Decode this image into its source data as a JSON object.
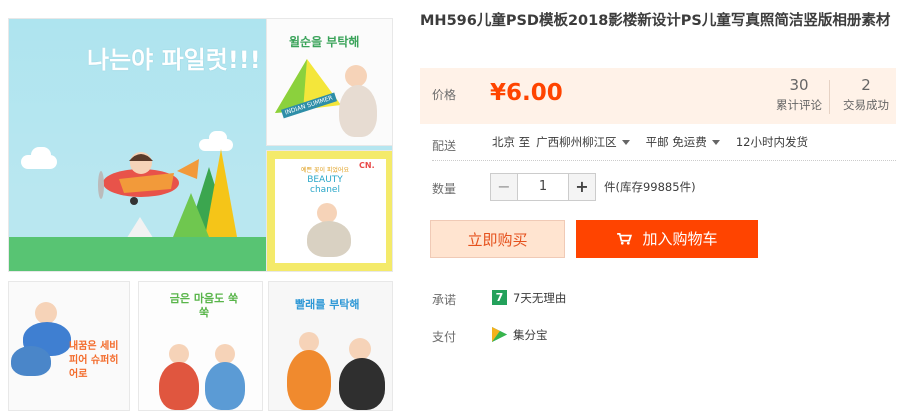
{
  "product": {
    "title": "MH596儿童PSD模板2018影楼新设计PS儿童写真照简洁竖版相册素材"
  },
  "price": {
    "label": "价格",
    "value": "¥6.00",
    "reviews_count": "30",
    "reviews_label": "累计评论",
    "sales_count": "2",
    "sales_label": "交易成功"
  },
  "shipping": {
    "label": "配送",
    "from": "北京 至",
    "to": "广西柳州柳江区",
    "method": "平邮 免运费",
    "dispatch": "12小时内发货"
  },
  "quantity": {
    "label": "数量",
    "minus": "−",
    "value": "1",
    "plus": "+",
    "stock": "件(库存99885件)"
  },
  "actions": {
    "buy_now": "立即购买",
    "add_to_cart": "加入购物车"
  },
  "service": {
    "promise_label": "承诺",
    "promise_badge": "7",
    "promise_text": "7天无理由",
    "pay_label": "支付",
    "pay_text": "集分宝"
  },
  "gallery": {
    "main_headline": "나는야 파일럿!!!",
    "thumb1_text": "윌순을 부탁해",
    "thumb1_banner": "INDIAN SUMMER",
    "thumb2_sub": "예쁜 꽃이 피었어요",
    "thumb2_title": "BEAUTY chanel",
    "thumb2_tag": "CN.",
    "thumb3_text": "내꿈은 세비피어 슈퍼히어로",
    "thumb4_text": "금은 마음도 쑥쑥",
    "thumb5_text": "빨래를 부탁해"
  },
  "colors": {
    "accent": "#ff4400",
    "price": "#ff4400",
    "price_bg": "#fff2e8",
    "buy_bg": "#ffe4d0",
    "badge_green": "#23a15b"
  }
}
